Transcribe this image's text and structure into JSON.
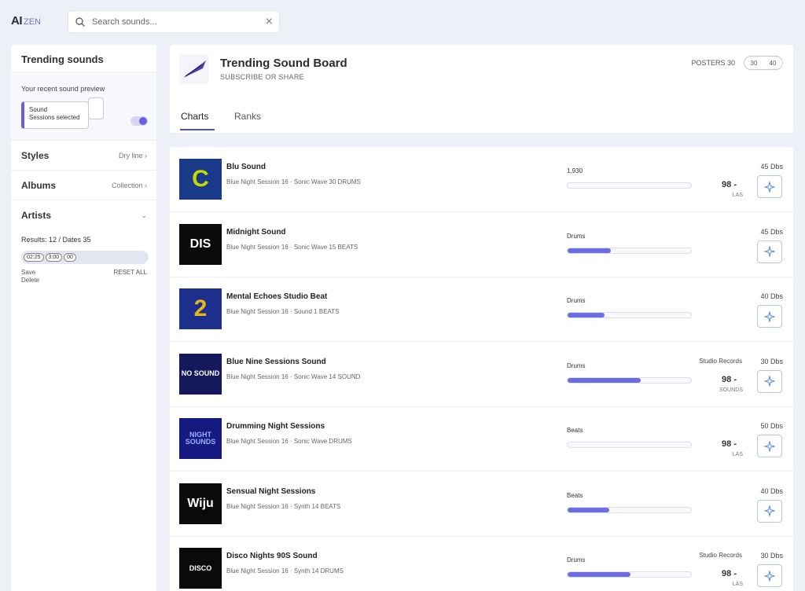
{
  "app": {
    "logo": "AI",
    "logo_sub": "ZEN"
  },
  "search": {
    "placeholder": "Search sounds..."
  },
  "sidebar": {
    "title": "Trending sounds",
    "card_label": "Your recent sound preview",
    "card_box_line1": "Sound",
    "card_box_line2": "Sessions selected",
    "filters": [
      {
        "name": "Styles",
        "meta": "Dry line ›"
      },
      {
        "name": "Albums",
        "meta": "Collection ›"
      },
      {
        "name": "Artists",
        "meta": "⌄"
      }
    ],
    "range_label": "Results: 12 / Dates 35",
    "range_chips": [
      "02:25",
      "3:00",
      "00"
    ],
    "foot_left_1": "Save",
    "foot_left_2": "Delete",
    "foot_right": "RESET ALL"
  },
  "header": {
    "title": "Trending Sound Board",
    "subtitle": "SUBSCRIBE OR SHARE",
    "right_text": "POSTERS 30",
    "pill_left": "30",
    "pill_right": "40",
    "tab_active": "Charts",
    "tab_other": "Ranks"
  },
  "rows": [
    {
      "title": "Blu Sound",
      "sub": "Blue Night Session 16 · Sonic Wave 30 DRUMS",
      "label": "1,930",
      "progress": 0.0,
      "mid": "",
      "num": "98 -",
      "unit": "LAS",
      "size": "45 Dbs",
      "thumb_bg": "#1a3a8a",
      "thumb_text": "C",
      "thumb_color": "#c9d600"
    },
    {
      "title": "Midnight Sound",
      "sub": "Blue Night Session 16 · Sonic Wave 15 BEATS",
      "label": "Drums",
      "progress": 0.35,
      "mid": "",
      "num": "",
      "unit": "",
      "size": "45 Dbs",
      "thumb_bg": "#0a0a0a",
      "thumb_text": "DIS",
      "thumb_color": "#ffffff"
    },
    {
      "title": "Mental Echoes Studio Beat",
      "sub": "Blue Night Session 16 · Sound 1 BEATS",
      "label": "Drums",
      "progress": 0.3,
      "mid": "",
      "num": "",
      "unit": "",
      "size": "40 Dbs",
      "thumb_bg": "#1c2f8c",
      "thumb_text": "2",
      "thumb_color": "#e8b416"
    },
    {
      "title": "Blue Nine Sessions Sound",
      "sub": "Blue Night Session 16 · Sonic Wave 14 SOUND",
      "label": "Drums",
      "progress": 0.59,
      "mid": "Studio Records",
      "num": "98 -",
      "unit": "SOUNDS",
      "size": "30 Dbs",
      "thumb_bg": "#16185c",
      "thumb_text": "NO SOUND",
      "thumb_color": "#ffffff"
    },
    {
      "title": "Drumming Night Sessions",
      "sub": "Blue Night Session 16 · Sonic Wave DRUMS",
      "label": "Beats",
      "progress": 0.0,
      "mid": "",
      "num": "98 -",
      "unit": "LAS",
      "size": "50 Dbs",
      "thumb_bg": "#141a80",
      "thumb_text": "NIGHT SOUNDS",
      "thumb_color": "#9ab0ff"
    },
    {
      "title": "Sensual Night Sessions",
      "sub": "Blue Night Session 16 · Synth 14 BEATS",
      "label": "Beats",
      "progress": 0.34,
      "mid": "",
      "num": "",
      "unit": "",
      "size": "40 Dbs",
      "thumb_bg": "#0a0a0a",
      "thumb_text": "Wiju",
      "thumb_color": "#ffffff"
    },
    {
      "title": "Disco Nights 90S Sound",
      "sub": "Blue Night Session 16 · Synth 14 DRUMS",
      "label": "Drums",
      "progress": 0.51,
      "mid": "Studio Records",
      "num": "98 -",
      "unit": "LAS",
      "size": "30 Dbs",
      "thumb_bg": "#0a0a0a",
      "thumb_text": "DISCO",
      "thumb_color": "#ffffff"
    }
  ],
  "colors": {
    "accent": "#6a6ee0",
    "background": "#eef0f7"
  }
}
